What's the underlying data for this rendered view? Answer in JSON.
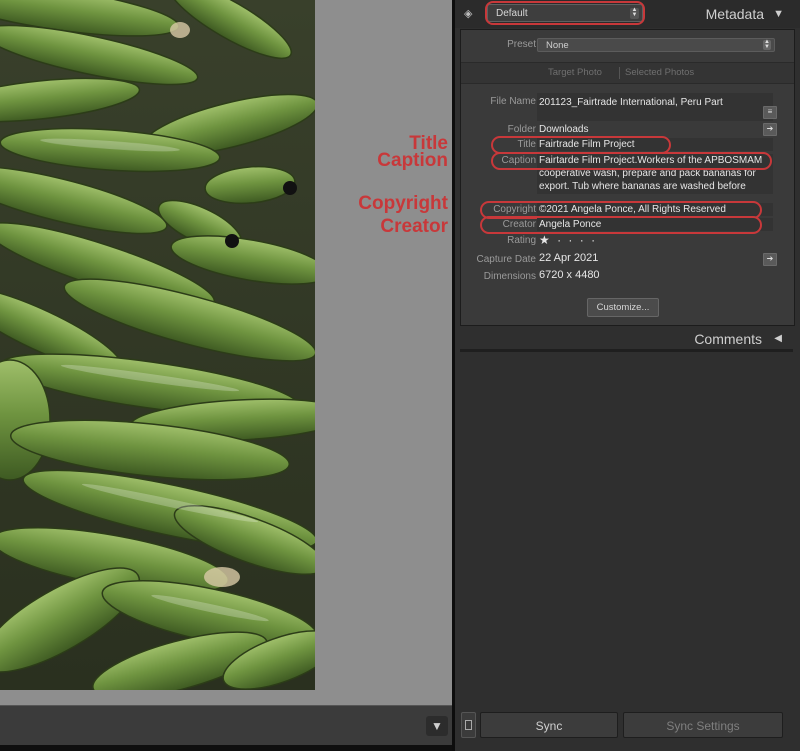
{
  "annotations": {
    "title": "Title",
    "caption": "Caption",
    "copyright": "Copyright",
    "creator": "Creator"
  },
  "panel": {
    "preset_dropdown": "Default",
    "title": "Metadata",
    "preset_label": "Preset",
    "preset_value": "None",
    "target_photo": "Target Photo",
    "selected_photos": "Selected Photos",
    "fields": {
      "file_name_label": "File Name",
      "file_name": "201123_Fairtrade International, Peru Part",
      "folder_label": "Folder",
      "folder": "Downloads",
      "title_label": "Title",
      "title": "Fairtrade Film Project",
      "caption_label": "Caption",
      "caption_line1": "Fairtarde Film Project.Workers of the APBOSMAM",
      "caption_line2": "cooperative wash, prepare and pack bananas for",
      "caption_line3": "export. Tub where bananas are washed before",
      "copyright_label": "Copyright",
      "copyright": "©2021 Angela Ponce, All Rights Reserved",
      "creator_label": "Creator",
      "creator": "Angela Ponce",
      "rating_label": "Rating",
      "rating": "★ · · · ·",
      "capture_date_label": "Capture Date",
      "capture_date": "22 Apr 2021",
      "dimensions_label": "Dimensions",
      "dimensions": "6720 x 4480"
    },
    "customize_label": "Customize...",
    "comments_label": "Comments",
    "sync_label": "Sync",
    "sync_settings_label": "Sync Settings"
  },
  "colors": {
    "annotation": "#c8383a",
    "panel_bg": "#2f2f2f",
    "photo_backdrop": "#8e8e8e"
  }
}
